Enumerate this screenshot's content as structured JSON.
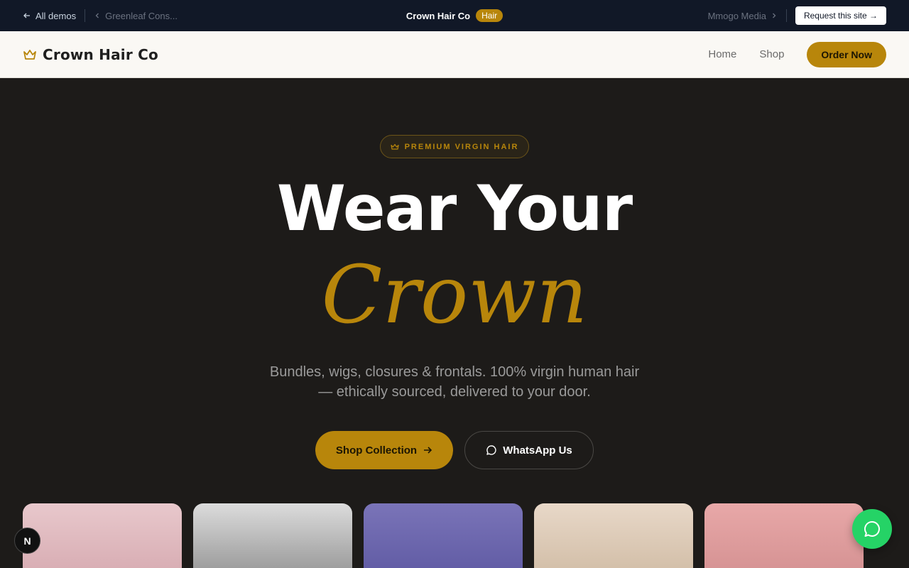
{
  "demo_bar": {
    "all_demos": "All demos",
    "prev_demo": "Greenleaf Cons...",
    "site_name": "Crown Hair Co",
    "badge": "Hair",
    "next_demo": "Mmogo Media",
    "request_button": "Request this site →"
  },
  "header": {
    "brand": "Crown Hair Co",
    "nav": [
      "Home",
      "Shop"
    ],
    "order_button": "Order Now"
  },
  "hero": {
    "pill": "PREMIUM VIRGIN HAIR",
    "headline_line1": "Wear Your",
    "headline_line2": "Crown",
    "subtitle": "Bundles, wigs, closures & frontals. 100% virgin human hair — ethically sourced, delivered to your door.",
    "primary_cta": "Shop Collection",
    "secondary_cta": "WhatsApp Us"
  },
  "floating": {
    "dev_badge_letter": "N"
  },
  "colors": {
    "accent": "#b8860b",
    "background": "#1d1b19",
    "header_bg": "#faf8f4",
    "demo_bar_bg": "#111827",
    "whatsapp": "#25d366"
  }
}
